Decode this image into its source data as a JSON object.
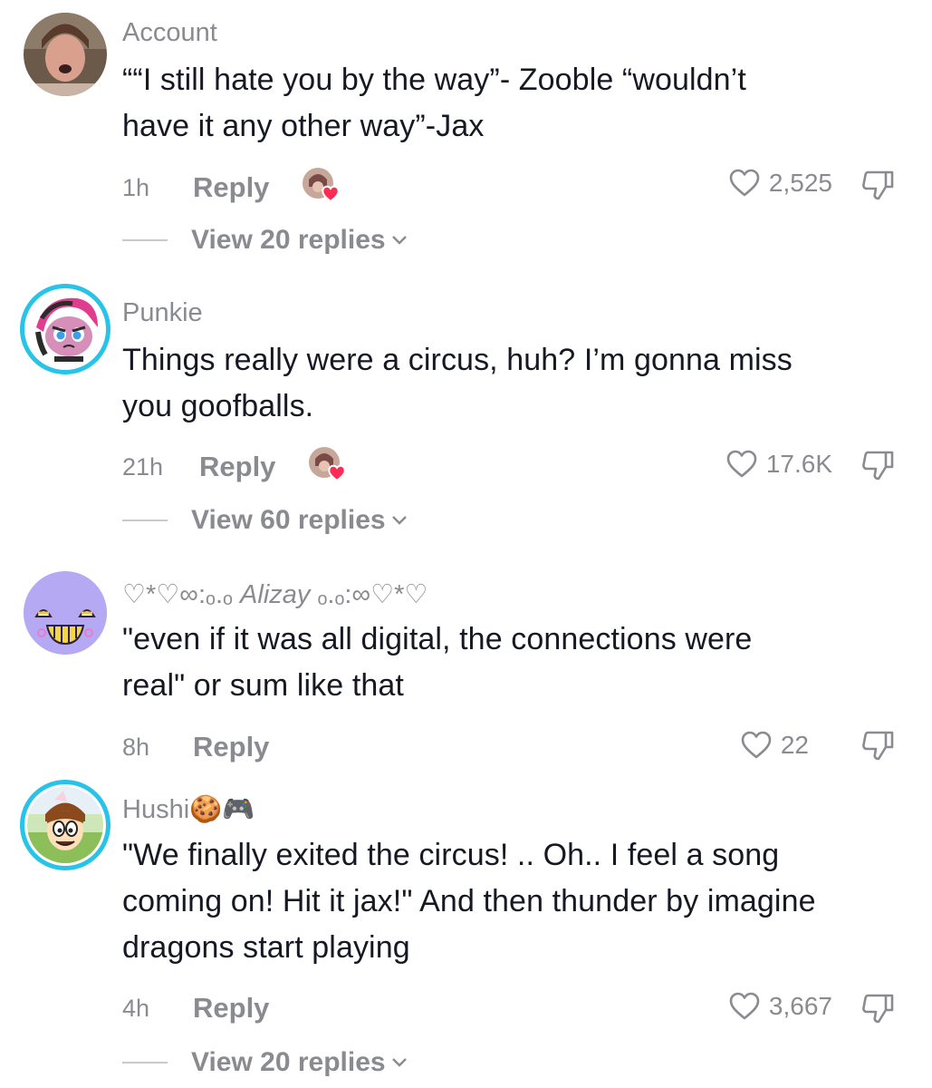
{
  "comments": [
    {
      "username": "Account",
      "text_line1": "““I still hate you by the way”- Zooble “wouldn’t",
      "text_line2": "have it any other way”-Jax",
      "time": "1h",
      "reply": "Reply",
      "likes": "2,525",
      "view_replies": "View 20 replies"
    },
    {
      "username": "Punkie",
      "text_line1": "Things really were a circus, huh? I’m gonna miss",
      "text_line2": "you goofballs.",
      "time": "21h",
      "reply": "Reply",
      "likes": "17.6K",
      "view_replies": "View 60 replies"
    },
    {
      "username_prefix": "♡*♡∞:ₒ.ₒ ",
      "username_name": "Alizay",
      "username_suffix": " ₒ.ₒ:∞♡*♡",
      "text_line1": "\"even if it was all digital, the connections were",
      "text_line2": "real\" or sum like that",
      "time": "8h",
      "reply": "Reply",
      "likes": "22"
    },
    {
      "username": "Hushi🍪🎮",
      "text_line1": "\"We finally exited the circus! .. Oh.. I feel a song",
      "text_line2": "coming on! Hit it jax!\" And then thunder by imagine",
      "text_line3": "dragons start playing",
      "time": "4h",
      "reply": "Reply",
      "likes": "3,667",
      "view_replies": "View 20 replies"
    }
  ],
  "colors": {
    "text": "#161823",
    "muted": "#8a8b91",
    "ring": "#27c3e8",
    "creator_heart": "#fe2c55"
  },
  "icons": [
    "heart-outline-icon",
    "thumbs-down-outline-icon",
    "chevron-down-icon",
    "creator-liked-heart-icon"
  ]
}
